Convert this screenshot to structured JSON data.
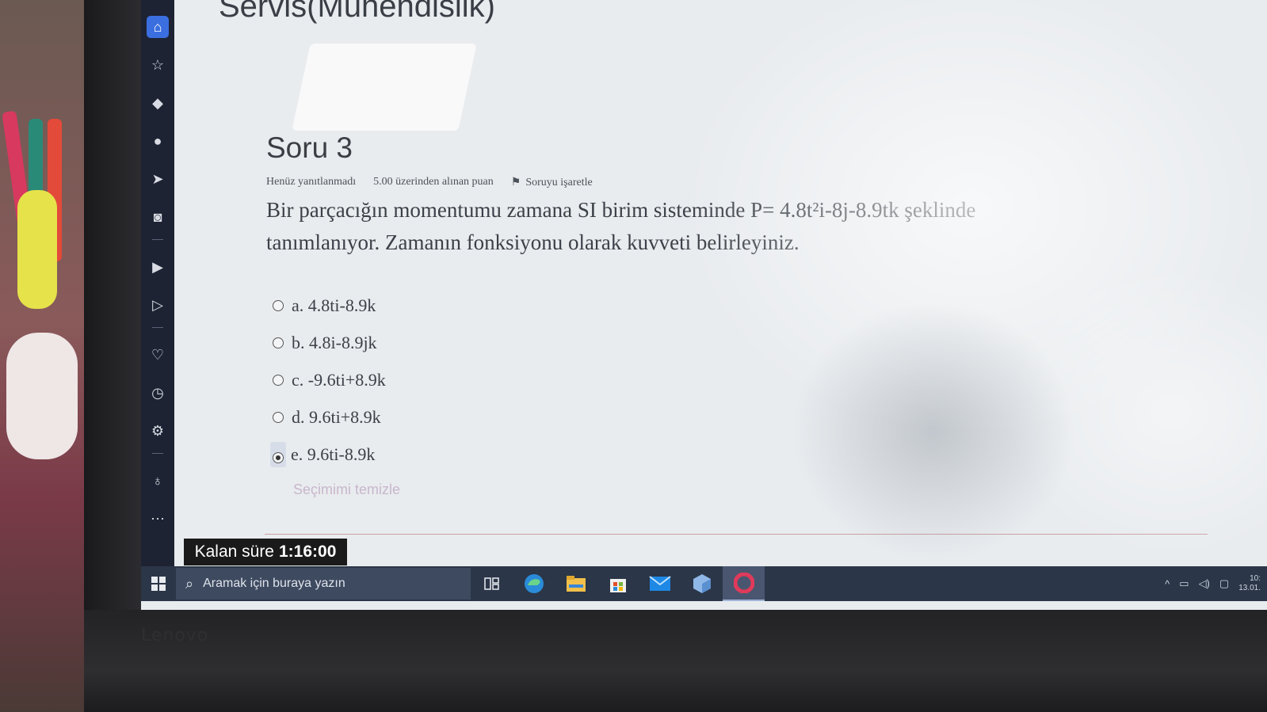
{
  "course": {
    "title": "Servis(Mühendislik)"
  },
  "question": {
    "title": "Soru 3",
    "status": "Henüz yanıtlanmadı",
    "points": "5.00 üzerinden alınan puan",
    "flag_label": "Soruyu işaretle",
    "text_line1": "Bir parçacığın momentumu zamana SI birim sisteminde P= 4.8t²i-8j-8.9tk şeklinde",
    "text_line2": "tanımlanıyor. Zamanın fonksiyonu olarak kuvveti belirleyiniz.",
    "options": [
      {
        "label": "a. 4.8ti-8.9k",
        "selected": false
      },
      {
        "label": "b. 4.8i-8.9jk",
        "selected": false
      },
      {
        "label": "c. -9.6ti+8.9k",
        "selected": false
      },
      {
        "label": "d. 9.6ti+8.9k",
        "selected": false
      },
      {
        "label": "e. 9.6ti-8.9k",
        "selected": true
      }
    ],
    "clear_label": "Seçimimi temizle"
  },
  "timer": {
    "label": "Kalan süre",
    "value": "1:16:00"
  },
  "taskbar": {
    "search_placeholder": "Aramak için buraya yazın",
    "clock_time": "10:",
    "clock_date": "13.01."
  },
  "laptop_brand": "Lenovo"
}
